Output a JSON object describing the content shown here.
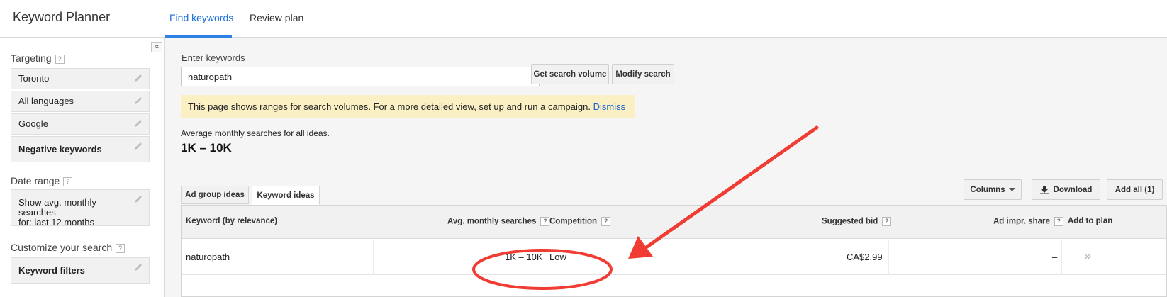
{
  "header": {
    "app_title": "Keyword Planner",
    "tabs": [
      {
        "label": "Find keywords",
        "active": true
      },
      {
        "label": "Review plan",
        "active": false
      }
    ]
  },
  "sidebar": {
    "collapse_icon": "«",
    "targeting": {
      "label": "Targeting",
      "help": "?",
      "items": [
        "Toronto",
        "All languages",
        "Google",
        "Negative keywords"
      ]
    },
    "date_range": {
      "label": "Date range",
      "help": "?",
      "value_line1": "Show avg. monthly searches",
      "value_line2": "for: last 12 months"
    },
    "customize": {
      "label": "Customize your search",
      "help": "?",
      "item": "Keyword filters"
    }
  },
  "main": {
    "enter_label": "Enter keywords",
    "keyword_value": "naturopath",
    "get_volume_button": "Get search volume",
    "modify_button": "Modify search",
    "notice_text": "This page shows ranges for search volumes. For a more detailed view, set up and run a campaign.",
    "notice_link": "Dismiss",
    "avg_label": "Average monthly searches for all ideas.",
    "avg_value": "1K – 10K",
    "result_tabs": [
      "Ad group ideas",
      "Keyword ideas"
    ],
    "columns_button": "Columns",
    "download_button": "Download",
    "add_all_button": "Add all (1)"
  },
  "table": {
    "headers": {
      "keyword": "Keyword (by relevance)",
      "avg": "Avg. monthly searches",
      "competition": "Competition",
      "bid": "Suggested bid",
      "share": "Ad impr. share",
      "add": "Add to plan",
      "help": "?"
    },
    "rows": [
      {
        "keyword": "naturopath",
        "avg": "1K – 10K",
        "competition": "Low",
        "bid": "CA$2.99",
        "share": "–",
        "add_icon": "»"
      }
    ]
  },
  "colors": {
    "accent": "#2e82e6",
    "notice_bg": "#fbf0c4",
    "annotation": "#f03c32"
  },
  "icons": [
    "pencil-icon",
    "download-icon",
    "caret-down-icon",
    "double-chevron-right-icon",
    "double-chevron-left-icon",
    "help-icon"
  ]
}
